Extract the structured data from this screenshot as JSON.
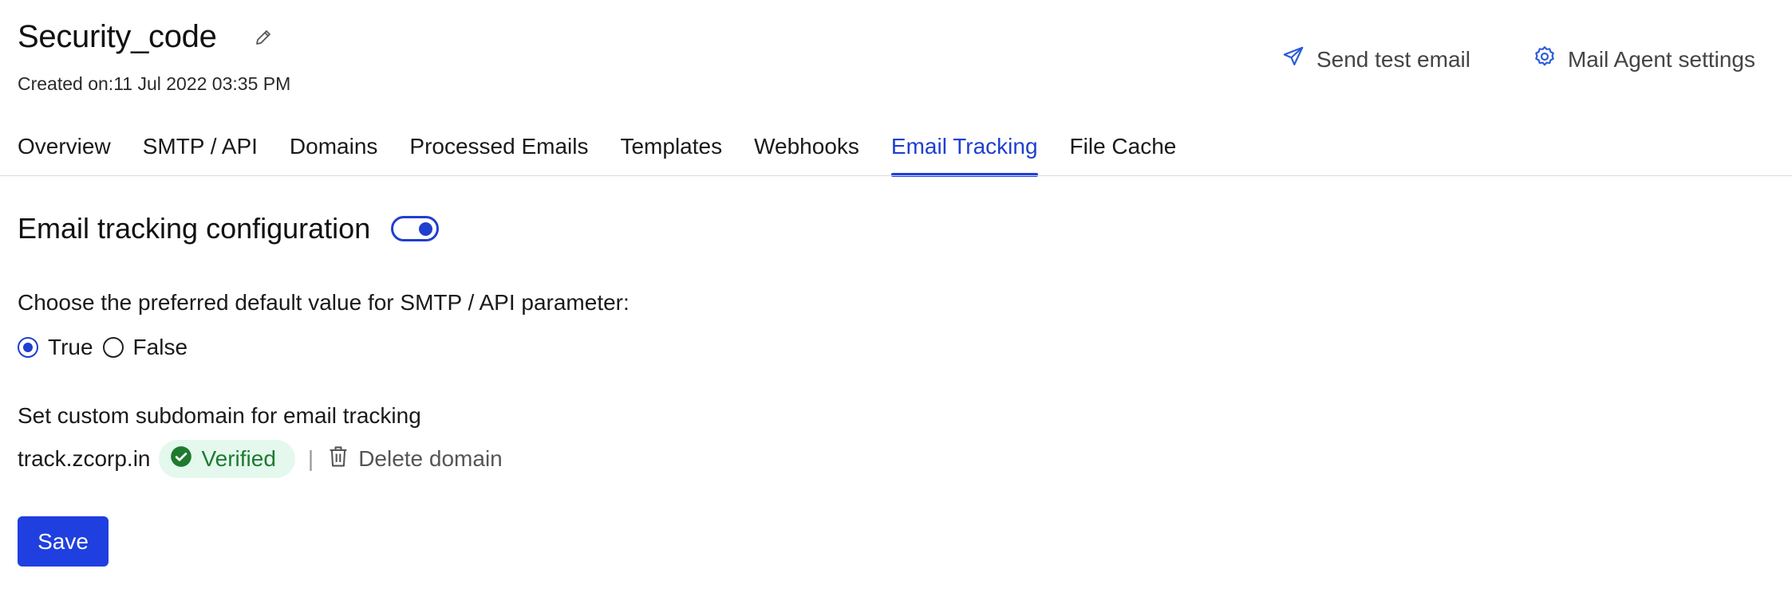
{
  "header": {
    "title": "Security_code",
    "created": "Created on:11 Jul 2022 03:35 PM",
    "actions": {
      "send_test_email": "Send test email",
      "mail_agent_settings": "Mail Agent settings"
    }
  },
  "tabs": [
    {
      "label": "Overview"
    },
    {
      "label": "SMTP / API"
    },
    {
      "label": "Domains"
    },
    {
      "label": "Processed Emails"
    },
    {
      "label": "Templates"
    },
    {
      "label": "Webhooks"
    },
    {
      "label": "Email Tracking",
      "active": true
    },
    {
      "label": "File Cache"
    }
  ],
  "tracking": {
    "title": "Email tracking configuration",
    "enabled": true,
    "question": "Choose the preferred default value for SMTP / API parameter:",
    "options": {
      "true_label": "True",
      "false_label": "False",
      "selected": "True"
    },
    "subdomain_label": "Set custom subdomain for email tracking",
    "domain": "track.zcorp.in",
    "status": "Verified",
    "separator": "|",
    "delete_label": "Delete domain"
  },
  "save_label": "Save",
  "colors": {
    "accent": "#1f3fe0",
    "verified_bg": "#e4f8ee",
    "verified_text": "#1e7a2e"
  }
}
